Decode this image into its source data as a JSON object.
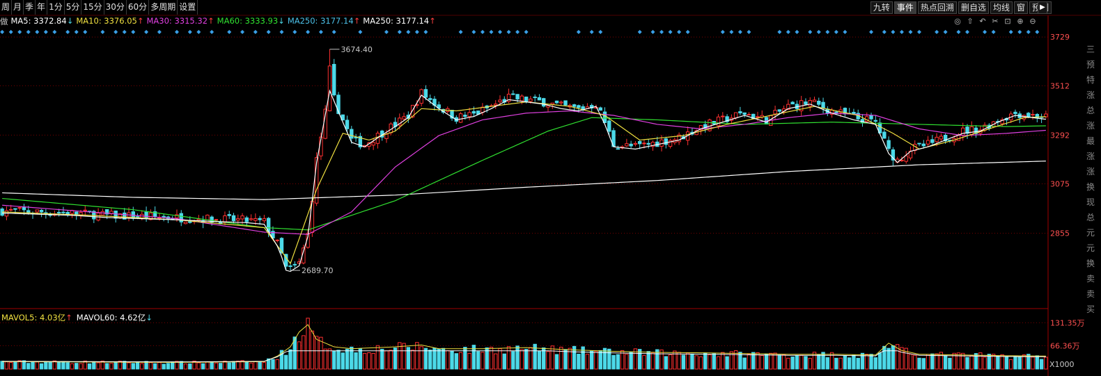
{
  "toolbar": {
    "periods": [
      "周",
      "月",
      "季",
      "年",
      "1分",
      "5分",
      "15分",
      "30分",
      "60分",
      "多周期",
      "设置"
    ],
    "right_tools": [
      "九转",
      "事件",
      "热点回溯",
      "删自选",
      "均线",
      "窗",
      "预测"
    ],
    "active_tool": "事件",
    "collapse_icon": "▶"
  },
  "ma_legend": [
    {
      "label": "MA5: 3372.84",
      "arrow": "↓",
      "color": "#ffffff"
    },
    {
      "label": "MA10: 3376.05",
      "arrow": "↑",
      "color": "#f0e040"
    },
    {
      "label": "MA30: 3315.32",
      "arrow": "↑",
      "color": "#e040e0"
    },
    {
      "label": "MA60: 3333.93",
      "arrow": "↓",
      "color": "#30e030"
    },
    {
      "label": "MA250: 3177.14",
      "arrow": "↑",
      "color": "#4cc0e8"
    },
    {
      "label": "MA250: 3177.14",
      "arrow": "↑",
      "color": "#ffffff"
    }
  ],
  "ma_legend_prefix": "做",
  "chart_icons": [
    "eye-icon",
    "pin-icon",
    "undo-icon",
    "scissors-icon",
    "lock-icon",
    "zoom-in-icon",
    "zoom-out-icon"
  ],
  "chart_icon_glyphs": [
    "◎",
    "⇧",
    "↶",
    "✂",
    "⊡",
    "⊕",
    "⊖"
  ],
  "vol_legend": [
    {
      "label": "MAVOL5: 4.03亿",
      "arrow": "↑",
      "color": "#f0e040"
    },
    {
      "label": "MAVOL60: 4.62亿",
      "arrow": "↓",
      "color": "#ffffff"
    }
  ],
  "right_strip": [
    "三",
    "预",
    "特",
    "涨",
    "总",
    "涨",
    "最",
    "涨",
    "涨",
    "换",
    "现",
    "总",
    "元",
    "元",
    "换",
    "卖",
    "卖",
    "买"
  ],
  "colors": {
    "up": "#ff3030",
    "down": "#4cd9e8",
    "grid": "#7a0000",
    "axis_label": "#ff5050",
    "ma5": "#ffffff",
    "ma10": "#f0e040",
    "ma30": "#e040e0",
    "ma60": "#30e030",
    "ma250": "#ffffff",
    "event_marker": "#3aa0e8"
  },
  "chart_data": {
    "type": "candlestick",
    "price_axis": {
      "ticks": [
        3729,
        3512,
        3292,
        3075,
        2855
      ],
      "ylim": [
        2600,
        3770
      ]
    },
    "volume_axis": {
      "ticks": [
        "131.35万",
        "66.36万"
      ],
      "unit_label": "X1000",
      "ylim": [
        0,
        140
      ]
    },
    "annotations": {
      "high": "3674.40",
      "low": "2689.70"
    },
    "high_value": 3674.4,
    "low_value": 2689.7,
    "candle_count": 240,
    "ma_series": [
      "MA5",
      "MA10",
      "MA30",
      "MA60",
      "MA250"
    ],
    "price_path": [
      [
        0,
        2955
      ],
      [
        8,
        2950
      ],
      [
        16,
        2945
      ],
      [
        24,
        2935
      ],
      [
        32,
        2930
      ],
      [
        40,
        2925
      ],
      [
        48,
        2918
      ],
      [
        56,
        2912
      ],
      [
        60,
        2905
      ],
      [
        63,
        2808
      ],
      [
        64,
        2760
      ],
      [
        65,
        2700
      ],
      [
        66,
        2695
      ],
      [
        68,
        2720
      ],
      [
        70,
        2850
      ],
      [
        72,
        3180
      ],
      [
        75,
        3500
      ],
      [
        78,
        3360
      ],
      [
        80,
        3270
      ],
      [
        83,
        3250
      ],
      [
        86,
        3290
      ],
      [
        90,
        3340
      ],
      [
        93,
        3380
      ],
      [
        96,
        3480
      ],
      [
        100,
        3420
      ],
      [
        104,
        3370
      ],
      [
        108,
        3385
      ],
      [
        112,
        3420
      ],
      [
        116,
        3460
      ],
      [
        120,
        3450
      ],
      [
        124,
        3440
      ],
      [
        128,
        3420
      ],
      [
        132,
        3410
      ],
      [
        136,
        3430
      ],
      [
        138,
        3350
      ],
      [
        140,
        3250
      ],
      [
        145,
        3240
      ],
      [
        150,
        3260
      ],
      [
        155,
        3280
      ],
      [
        160,
        3330
      ],
      [
        165,
        3360
      ],
      [
        170,
        3390
      ],
      [
        175,
        3360
      ],
      [
        180,
        3420
      ],
      [
        185,
        3440
      ],
      [
        190,
        3400
      ],
      [
        195,
        3370
      ],
      [
        200,
        3350
      ],
      [
        203,
        3220
      ],
      [
        205,
        3180
      ],
      [
        208,
        3230
      ],
      [
        212,
        3250
      ],
      [
        216,
        3280
      ],
      [
        220,
        3310
      ],
      [
        224,
        3320
      ],
      [
        228,
        3360
      ],
      [
        232,
        3390
      ],
      [
        236,
        3380
      ],
      [
        240,
        3370
      ]
    ],
    "ma10_path": [
      [
        0,
        2950
      ],
      [
        20,
        2935
      ],
      [
        40,
        2915
      ],
      [
        60,
        2880
      ],
      [
        66,
        2720
      ],
      [
        72,
        3050
      ],
      [
        78,
        3300
      ],
      [
        84,
        3270
      ],
      [
        90,
        3310
      ],
      [
        96,
        3410
      ],
      [
        104,
        3400
      ],
      [
        112,
        3420
      ],
      [
        120,
        3440
      ],
      [
        130,
        3420
      ],
      [
        138,
        3380
      ],
      [
        146,
        3270
      ],
      [
        156,
        3290
      ],
      [
        166,
        3340
      ],
      [
        176,
        3380
      ],
      [
        186,
        3420
      ],
      [
        196,
        3380
      ],
      [
        204,
        3300
      ],
      [
        210,
        3230
      ],
      [
        218,
        3270
      ],
      [
        226,
        3320
      ],
      [
        234,
        3370
      ],
      [
        240,
        3375
      ]
    ],
    "ma30_path": [
      [
        0,
        2980
      ],
      [
        20,
        2950
      ],
      [
        40,
        2920
      ],
      [
        60,
        2860
      ],
      [
        70,
        2850
      ],
      [
        80,
        2950
      ],
      [
        90,
        3150
      ],
      [
        100,
        3290
      ],
      [
        110,
        3360
      ],
      [
        120,
        3390
      ],
      [
        130,
        3400
      ],
      [
        140,
        3380
      ],
      [
        150,
        3340
      ],
      [
        160,
        3320
      ],
      [
        170,
        3340
      ],
      [
        180,
        3370
      ],
      [
        190,
        3390
      ],
      [
        200,
        3380
      ],
      [
        210,
        3320
      ],
      [
        220,
        3290
      ],
      [
        230,
        3300
      ],
      [
        240,
        3315
      ]
    ],
    "ma60_path": [
      [
        0,
        3010
      ],
      [
        30,
        2960
      ],
      [
        60,
        2880
      ],
      [
        70,
        2870
      ],
      [
        90,
        3000
      ],
      [
        110,
        3180
      ],
      [
        125,
        3310
      ],
      [
        135,
        3370
      ],
      [
        150,
        3360
      ],
      [
        170,
        3340
      ],
      [
        190,
        3350
      ],
      [
        210,
        3340
      ],
      [
        230,
        3330
      ],
      [
        240,
        3334
      ]
    ],
    "ma250_path": [
      [
        0,
        3035
      ],
      [
        30,
        3015
      ],
      [
        60,
        3005
      ],
      [
        90,
        3025
      ],
      [
        120,
        3060
      ],
      [
        150,
        3090
      ],
      [
        180,
        3130
      ],
      [
        210,
        3160
      ],
      [
        240,
        3177
      ]
    ],
    "volume_path": [
      [
        0,
        20
      ],
      [
        40,
        18
      ],
      [
        60,
        20
      ],
      [
        63,
        35
      ],
      [
        66,
        60
      ],
      [
        68,
        100
      ],
      [
        70,
        120
      ],
      [
        72,
        80
      ],
      [
        76,
        60
      ],
      [
        80,
        55
      ],
      [
        90,
        60
      ],
      [
        96,
        65
      ],
      [
        100,
        55
      ],
      [
        110,
        55
      ],
      [
        120,
        58
      ],
      [
        130,
        52
      ],
      [
        140,
        48
      ],
      [
        150,
        45
      ],
      [
        160,
        44
      ],
      [
        170,
        42
      ],
      [
        180,
        40
      ],
      [
        190,
        40
      ],
      [
        200,
        38
      ],
      [
        203,
        70
      ],
      [
        206,
        50
      ],
      [
        210,
        40
      ],
      [
        220,
        38
      ],
      [
        230,
        36
      ],
      [
        240,
        35
      ]
    ]
  }
}
